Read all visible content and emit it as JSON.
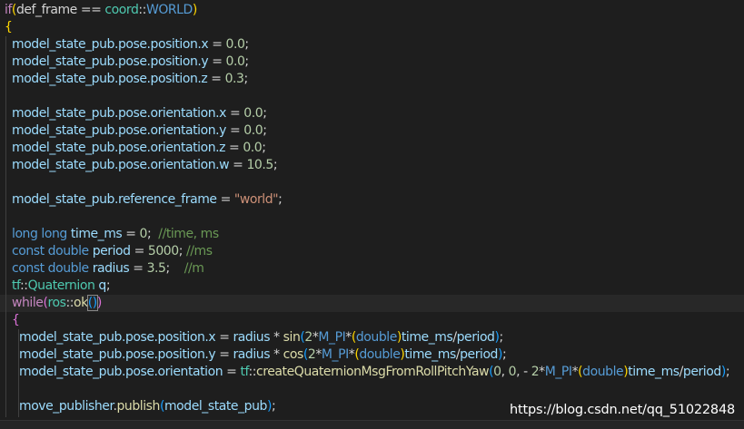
{
  "code_lines": [
    [
      {
        "t": "if",
        "c": "ctrl"
      },
      {
        "t": "(",
        "c": "brace1"
      },
      {
        "t": "def_frame",
        "c": "pl"
      },
      {
        "t": " == ",
        "c": "pl"
      },
      {
        "t": "coord",
        "c": "type"
      },
      {
        "t": "::",
        "c": "pl"
      },
      {
        "t": "WORLD",
        "c": "kw"
      },
      {
        "t": ")",
        "c": "brace1"
      }
    ],
    [
      {
        "t": "{",
        "c": "brace1"
      }
    ],
    [
      {
        "t": "  model_state_pub.pose.position.x",
        "c": "var"
      },
      {
        "t": " = ",
        "c": "pl"
      },
      {
        "t": "0.0",
        "c": "num"
      },
      {
        "t": ";",
        "c": "pl"
      }
    ],
    [
      {
        "t": "  model_state_pub.pose.position.y",
        "c": "var"
      },
      {
        "t": " = ",
        "c": "pl"
      },
      {
        "t": "0.0",
        "c": "num"
      },
      {
        "t": ";",
        "c": "pl"
      }
    ],
    [
      {
        "t": "  model_state_pub.pose.position.z",
        "c": "var"
      },
      {
        "t": " = ",
        "c": "pl"
      },
      {
        "t": "0.3",
        "c": "num"
      },
      {
        "t": ";",
        "c": "pl"
      }
    ],
    [],
    [
      {
        "t": "  model_state_pub.pose.orientation.x",
        "c": "var"
      },
      {
        "t": " = ",
        "c": "pl"
      },
      {
        "t": "0.0",
        "c": "num"
      },
      {
        "t": ";",
        "c": "pl"
      }
    ],
    [
      {
        "t": "  model_state_pub.pose.orientation.y",
        "c": "var"
      },
      {
        "t": " = ",
        "c": "pl"
      },
      {
        "t": "0.0",
        "c": "num"
      },
      {
        "t": ";",
        "c": "pl"
      }
    ],
    [
      {
        "t": "  model_state_pub.pose.orientation.z",
        "c": "var"
      },
      {
        "t": " = ",
        "c": "pl"
      },
      {
        "t": "0.0",
        "c": "num"
      },
      {
        "t": ";",
        "c": "pl"
      }
    ],
    [
      {
        "t": "  model_state_pub.pose.orientation.w",
        "c": "var"
      },
      {
        "t": " = ",
        "c": "pl"
      },
      {
        "t": "10.5",
        "c": "num"
      },
      {
        "t": ";",
        "c": "pl"
      }
    ],
    [],
    [
      {
        "t": "  model_state_pub.reference_frame",
        "c": "var"
      },
      {
        "t": " = ",
        "c": "pl"
      },
      {
        "t": "\"world\"",
        "c": "str"
      },
      {
        "t": ";",
        "c": "pl"
      }
    ],
    [],
    [
      {
        "t": "  long long ",
        "c": "kw"
      },
      {
        "t": "time_ms",
        "c": "var"
      },
      {
        "t": " = ",
        "c": "pl"
      },
      {
        "t": "0",
        "c": "num"
      },
      {
        "t": ";  ",
        "c": "pl"
      },
      {
        "t": "//time, ms",
        "c": "com"
      }
    ],
    [
      {
        "t": "  const double ",
        "c": "kw"
      },
      {
        "t": "period",
        "c": "var"
      },
      {
        "t": " = ",
        "c": "pl"
      },
      {
        "t": "5000",
        "c": "num"
      },
      {
        "t": "; ",
        "c": "pl"
      },
      {
        "t": "//ms",
        "c": "com"
      }
    ],
    [
      {
        "t": "  const double ",
        "c": "kw"
      },
      {
        "t": "radius",
        "c": "var"
      },
      {
        "t": " = ",
        "c": "pl"
      },
      {
        "t": "3.5",
        "c": "num"
      },
      {
        "t": ";    ",
        "c": "pl"
      },
      {
        "t": "//m",
        "c": "com"
      }
    ],
    [
      {
        "t": "  tf",
        "c": "type"
      },
      {
        "t": "::",
        "c": "pl"
      },
      {
        "t": "Quaternion",
        "c": "type"
      },
      {
        "t": " q",
        "c": "var"
      },
      {
        "t": ";",
        "c": "pl"
      }
    ],
    [
      {
        "t": "  while",
        "c": "ctrl"
      },
      {
        "t": "(",
        "c": "brace2"
      },
      {
        "t": "ros",
        "c": "type"
      },
      {
        "t": "::",
        "c": "pl"
      },
      {
        "t": "ok",
        "c": "fn"
      },
      {
        "t": "()",
        "c": "brace3",
        "box": true
      },
      {
        "t": ")",
        "c": "brace2"
      }
    ],
    [
      {
        "t": "  {",
        "c": "brace2"
      }
    ],
    [
      {
        "t": "    model_state_pub.pose.position.x",
        "c": "var"
      },
      {
        "t": " = ",
        "c": "pl"
      },
      {
        "t": "radius",
        "c": "var"
      },
      {
        "t": " * ",
        "c": "pl"
      },
      {
        "t": "sin",
        "c": "fn"
      },
      {
        "t": "(",
        "c": "brace3"
      },
      {
        "t": "2",
        "c": "num"
      },
      {
        "t": "*",
        "c": "pl"
      },
      {
        "t": "M_PI",
        "c": "mac"
      },
      {
        "t": "*",
        "c": "pl"
      },
      {
        "t": "(",
        "c": "brace1"
      },
      {
        "t": "double",
        "c": "kw"
      },
      {
        "t": ")",
        "c": "brace1"
      },
      {
        "t": "time_ms",
        "c": "var"
      },
      {
        "t": "/",
        "c": "pl"
      },
      {
        "t": "period",
        "c": "var"
      },
      {
        "t": ")",
        "c": "brace3"
      },
      {
        "t": ";",
        "c": "pl"
      }
    ],
    [
      {
        "t": "    model_state_pub.pose.position.y",
        "c": "var"
      },
      {
        "t": " = ",
        "c": "pl"
      },
      {
        "t": "radius",
        "c": "var"
      },
      {
        "t": " * ",
        "c": "pl"
      },
      {
        "t": "cos",
        "c": "fn"
      },
      {
        "t": "(",
        "c": "brace3"
      },
      {
        "t": "2",
        "c": "num"
      },
      {
        "t": "*",
        "c": "pl"
      },
      {
        "t": "M_PI",
        "c": "mac"
      },
      {
        "t": "*",
        "c": "pl"
      },
      {
        "t": "(",
        "c": "brace1"
      },
      {
        "t": "double",
        "c": "kw"
      },
      {
        "t": ")",
        "c": "brace1"
      },
      {
        "t": "time_ms",
        "c": "var"
      },
      {
        "t": "/",
        "c": "pl"
      },
      {
        "t": "period",
        "c": "var"
      },
      {
        "t": ")",
        "c": "brace3"
      },
      {
        "t": ";",
        "c": "pl"
      }
    ],
    [
      {
        "t": "    model_state_pub.pose.orientation",
        "c": "var"
      },
      {
        "t": " = ",
        "c": "pl"
      },
      {
        "t": "tf",
        "c": "type"
      },
      {
        "t": "::",
        "c": "pl"
      },
      {
        "t": "createQuaternionMsgFromRollPitchYaw",
        "c": "fn"
      },
      {
        "t": "(",
        "c": "brace3"
      },
      {
        "t": "0",
        "c": "num"
      },
      {
        "t": ", ",
        "c": "pl"
      },
      {
        "t": "0",
        "c": "num"
      },
      {
        "t": ", - ",
        "c": "pl"
      },
      {
        "t": "2",
        "c": "num"
      },
      {
        "t": "*",
        "c": "pl"
      },
      {
        "t": "M_PI",
        "c": "mac"
      },
      {
        "t": "*",
        "c": "pl"
      },
      {
        "t": "(",
        "c": "brace1"
      },
      {
        "t": "double",
        "c": "kw"
      },
      {
        "t": ")",
        "c": "brace1"
      },
      {
        "t": "time_ms",
        "c": "var"
      },
      {
        "t": "/",
        "c": "pl"
      },
      {
        "t": "period",
        "c": "var"
      },
      {
        "t": ")",
        "c": "brace3"
      },
      {
        "t": ";",
        "c": "pl"
      }
    ],
    [],
    [
      {
        "t": "    move_publisher",
        "c": "var"
      },
      {
        "t": ".",
        "c": "pl"
      },
      {
        "t": "publish",
        "c": "fn"
      },
      {
        "t": "(",
        "c": "brace3"
      },
      {
        "t": "model_state_pub",
        "c": "var"
      },
      {
        "t": ")",
        "c": "brace3"
      },
      {
        "t": ";",
        "c": "pl"
      }
    ]
  ],
  "watermark": "https://blog.csdn.net/qq_51022848"
}
